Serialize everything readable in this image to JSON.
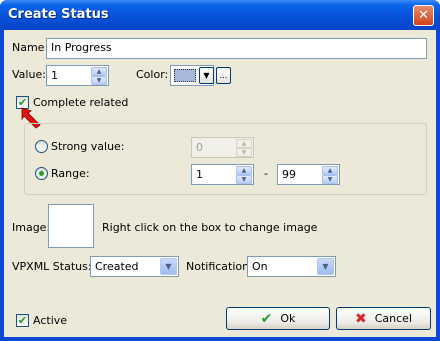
{
  "window": {
    "title": "Create Status",
    "close_glyph": "✕"
  },
  "form": {
    "name_label": "Name",
    "name_value": "In Progress",
    "value_label": "Value:",
    "value_value": "1",
    "color_label": "Color:",
    "color_swatch": "#a8b8dc",
    "color_more_glyph": "...",
    "complete_related_label": "Complete related",
    "complete_related_checked": true,
    "strong_value_label": "Strong value:",
    "strong_value_value": "0",
    "range_label": "Range:",
    "range_from": "1",
    "range_separator": "-",
    "range_to": "99",
    "image_label": "Image:",
    "image_hint": "Right click on the box to  change image",
    "vpxml_status_label": "VPXML Status:",
    "vpxml_status_value": "Created",
    "notification_label": "Notification:",
    "notification_value": "On",
    "active_label": "Active",
    "active_checked": true
  },
  "buttons": {
    "ok": "Ok",
    "cancel": "Cancel"
  },
  "icons": {
    "ok_icon": "checkmark-icon",
    "cancel_icon": "x-icon",
    "pointer": "red-arrow-icon"
  },
  "colors": {
    "title_bar": "#0650d6",
    "client_bg": "#ece9d8",
    "check_green": "#21a121",
    "arrow_red": "#e01010"
  }
}
